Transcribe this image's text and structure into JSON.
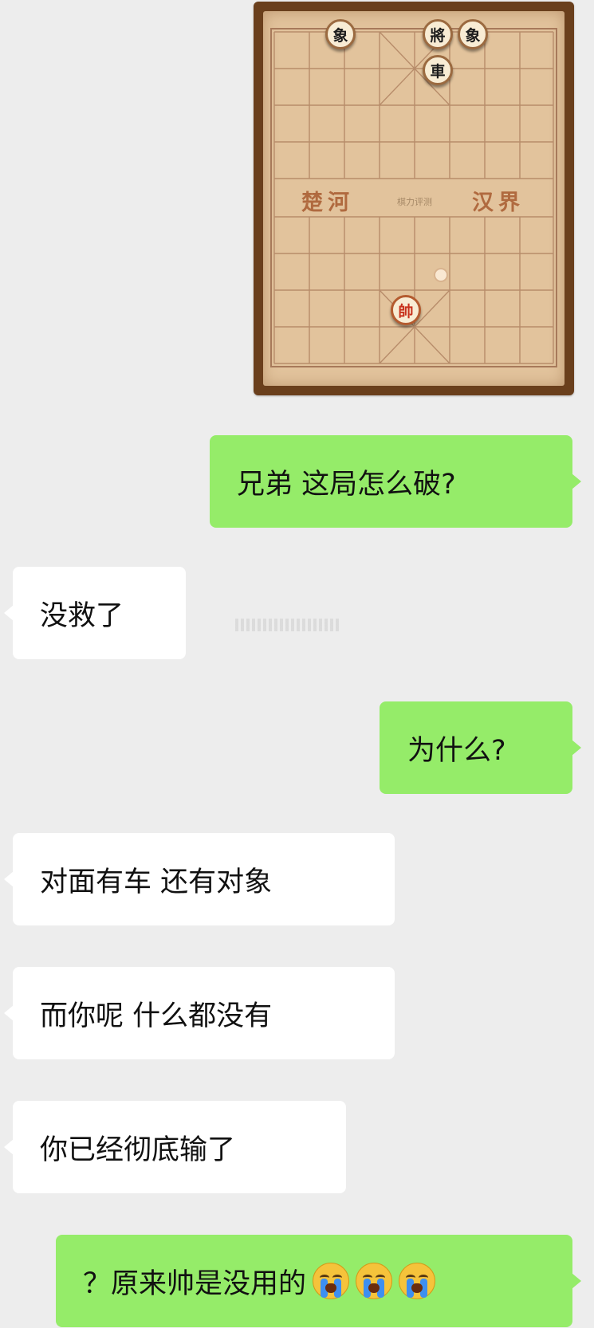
{
  "board": {
    "river_left": "楚河",
    "river_right": "汉界",
    "river_mid": "棋力评测",
    "pieces": {
      "elephant_left": "象",
      "general": "將",
      "elephant_right": "象",
      "chariot": "車",
      "marshal": "帥"
    }
  },
  "messages": [
    {
      "side": "right",
      "text": "兄弟 这局怎么破?"
    },
    {
      "side": "left",
      "text": "没救了"
    },
    {
      "side": "right",
      "text": "为什么?"
    },
    {
      "side": "left",
      "text": "对面有车 还有对象"
    },
    {
      "side": "left",
      "text": "而你呢 什么都没有"
    },
    {
      "side": "left",
      "text": "你已经彻底输了"
    },
    {
      "side": "right",
      "text": "？原来帅是没用的",
      "emoji": "loudly-crying-face",
      "emoji_count": 3
    }
  ]
}
